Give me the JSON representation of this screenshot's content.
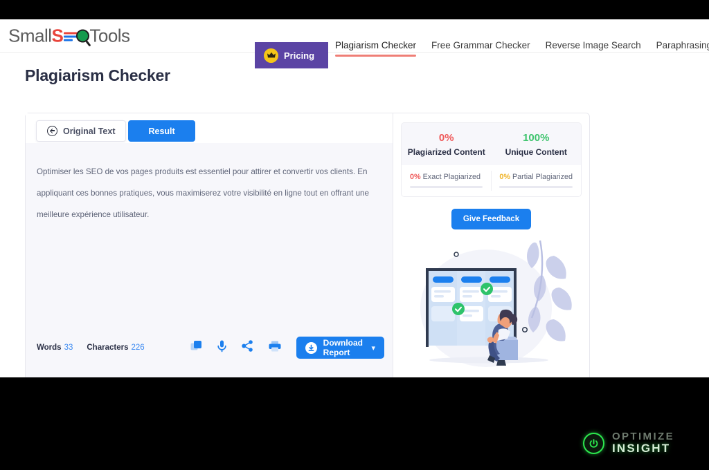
{
  "header": {
    "logo": {
      "part1": "Small",
      "s": "S",
      "o": "O",
      "part2": "Tools"
    },
    "pricing_label": "Pricing",
    "pricing_icon": "crown-icon",
    "nav_items": [
      {
        "label": "Plagiarism Checker",
        "active": true
      },
      {
        "label": "Free Grammar Checker",
        "active": false
      },
      {
        "label": "Reverse Image Search",
        "active": false
      },
      {
        "label": "Paraphrasing To",
        "active": false
      }
    ]
  },
  "page_title": "Plagiarism Checker",
  "editor": {
    "tabs": [
      {
        "label": "Original Text",
        "active": false,
        "icon": "back-arrow-circle-icon"
      },
      {
        "label": "Result",
        "active": true
      }
    ],
    "content": "Optimiser les SEO de vos pages produits est essentiel pour attirer et convertir vos clients. En appliquant ces bonnes pratiques, vous maximiserez votre visibilité en ligne tout en offrant une meilleure expérience utilisateur.",
    "words_label": "Words",
    "words_value": "33",
    "characters_label": "Characters",
    "characters_value": "226",
    "tool_icons": [
      "copy-icon",
      "microphone-icon",
      "share-icon",
      "print-icon"
    ],
    "download_label": "Download Report",
    "download_icon": "download-circle-icon",
    "download_chevron": "chevron-down-icon"
  },
  "result": {
    "stats": [
      {
        "pct": "0%",
        "label": "Plagiarized Content",
        "color": "#ef5a5a"
      },
      {
        "pct": "100%",
        "label": "Unique Content",
        "color": "#3ec46d"
      }
    ],
    "sub_stats": [
      {
        "pct": "0%",
        "label": "Exact Plagiarized",
        "color": "#ef5a5a"
      },
      {
        "pct": "0%",
        "label": "Partial Plagiarized",
        "color": "#f0b429"
      }
    ],
    "feedback_label": "Give Feedback",
    "illustration": "kanban-board-illustration"
  },
  "watermark": {
    "line1": "OPTIMIZE",
    "line2": "INSIGHT",
    "icon": "power-icon"
  }
}
